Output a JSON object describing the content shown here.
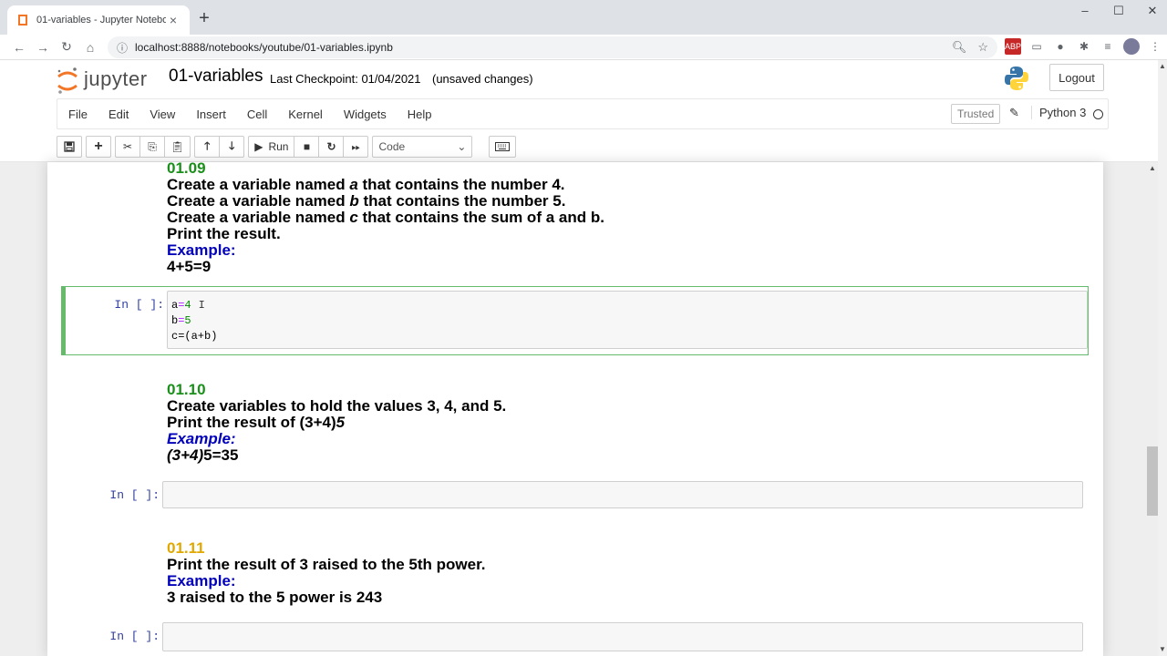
{
  "browser": {
    "tab_title": "01-variables - Jupyter Notebook",
    "url": "localhost:8888/notebooks/youtube/01-variables.ipynb"
  },
  "jupyter": {
    "logo_text": "jupyter",
    "notebook_name": "01-variables",
    "checkpoint": "Last Checkpoint: 01/04/2021",
    "unsaved": "(unsaved changes)",
    "logout_label": "Logout",
    "trusted_label": "Trusted",
    "kernel_name": "Python 3"
  },
  "menu": [
    "File",
    "Edit",
    "View",
    "Insert",
    "Cell",
    "Kernel",
    "Widgets",
    "Help"
  ],
  "toolbar": {
    "run_label": "Run",
    "cell_type": "Code"
  },
  "cells": {
    "md1": {
      "number": "01.09",
      "line1_pre": "Create a variable named ",
      "line1_var": "a",
      "line1_post": " that contains the number 4.",
      "line2_pre": "Create a variable named ",
      "line2_var": "b",
      "line2_post": " that contains the number 5.",
      "line3_pre": "Create a variable named ",
      "line3_var": "c",
      "line3_post": " that contains the sum of a and b.",
      "line4": "Print the result.",
      "example_label": "Example:",
      "example": "4+5=9"
    },
    "code1": {
      "prompt": "In [ ]:",
      "line1_var": "a",
      "line1_eq": "=",
      "line1_val": "4",
      "line2_var": "b",
      "line2_eq": "=",
      "line2_val": "5",
      "line3": "c=(a+b)"
    },
    "md2": {
      "number": "01.10",
      "line1": "Create variables to hold the values 3, 4, and 5.",
      "line2_pre": "Print the result of (3+4)",
      "line2_it": "5",
      "example_label": "Example:",
      "example_it": "(3+4)",
      "example_post": "5=35"
    },
    "code2": {
      "prompt": "In [ ]:"
    },
    "md3": {
      "number": "01.11",
      "line1": "Print the result of 3 raised to the 5th power.",
      "example_label": "Example:",
      "example": "3 raised to the 5 power is 243"
    },
    "code3": {
      "prompt": "In [ ]:"
    }
  },
  "colors": {
    "green_heading": "#1a8f1a",
    "gold_heading": "#e0a800",
    "example_blue": "#0000bb",
    "selected_border": "#66bb6a"
  }
}
